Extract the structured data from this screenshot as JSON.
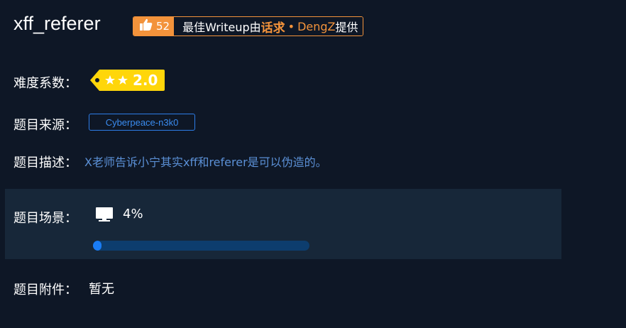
{
  "challenge": {
    "title": "xff_referer"
  },
  "writeup_badge": {
    "likes": "52",
    "prefix": "最佳Writeup由",
    "author": "话求",
    "separator": "•",
    "contributor": "DengZ",
    "suffix": "提供"
  },
  "difficulty": {
    "label": "难度系数：",
    "value": "2.0",
    "stars": 2
  },
  "source": {
    "label": "题目来源：",
    "value": "Cyberpeace-n3k0"
  },
  "description": {
    "label": "题目描述：",
    "value": "X老师告诉小宁其实xff和referer是可以伪造的。"
  },
  "scene": {
    "label": "题目场景：",
    "progress_text": "4%",
    "progress_value": 0.04
  },
  "attachment": {
    "label": "题目附件：",
    "value": "暂无"
  },
  "colors": {
    "background": "#0e1726",
    "accent_orange": "#f3933b",
    "badge_yellow": "#ffd60a",
    "link_blue": "#3a8cf0",
    "progress_fill": "#1a7cf5",
    "progress_track": "#0d3d6e"
  }
}
